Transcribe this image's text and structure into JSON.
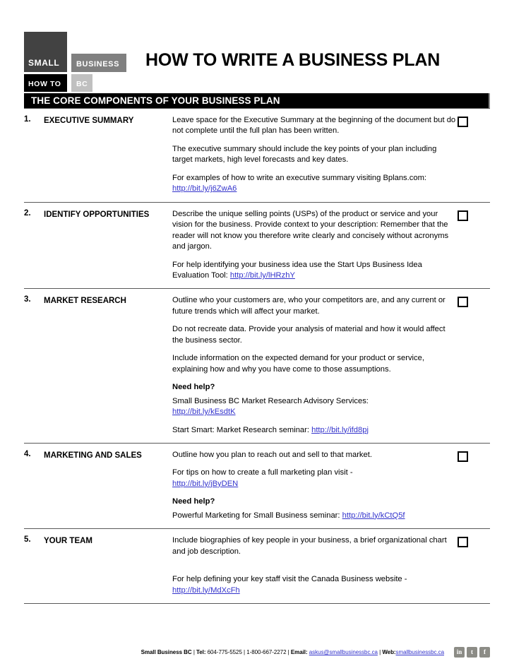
{
  "logo": {
    "small": "SMALL",
    "business": "BUSINESS",
    "how_to": "HOW TO",
    "bc": "BC",
    "colors": {
      "small_bg": "#424242",
      "business_bg": "#808080",
      "how_to_bg": "#000000",
      "bc_bg": "#c0c0c0"
    }
  },
  "title": "HOW TO WRITE A BUSINESS PLAN",
  "banner": "THE CORE COMPONENTS OF YOUR BUSINESS PLAN",
  "sections": [
    {
      "number": "1.",
      "name": "EXECUTIVE SUMMARY",
      "p1": "Leave space for the Executive Summary at the beginning of the document but do not complete until the full plan has been written.",
      "p2": "The executive summary should include the key points of your plan including target markets, high level forecasts and key dates.",
      "p3_text": "For examples of how to write an executive summary visiting Bplans.com: ",
      "p3_link": "http://bit.ly/j6ZwA6"
    },
    {
      "number": "2.",
      "name": "IDENTIFY OPPORTUNITIES",
      "p1": "Describe the unique selling points (USPs) of the product or service and your vision for the business.  Provide context to your description: Remember that the reader will not know you therefore write clearly and concisely without acronyms and jargon.",
      "p2_text": "For help identifying your business idea use the Start Ups Business Idea Evaluation Tool: ",
      "p2_link": "http://bit.ly/lHRzhY"
    },
    {
      "number": "3.",
      "name": "MARKET RESEARCH",
      "p1": "Outline who your customers are, who your competitors are, and any current or future trends which will affect your market.",
      "p2": "Do not recreate data. Provide your analysis of material and how it would affect the business sector.",
      "p3": "Include information on the expected demand for your product or service, explaining how and why you have come to those assumptions.",
      "need_help": "Need help?",
      "p4_text": "Small Business BC Market Research Advisory Services: ",
      "p4_link": "http://bit.ly/kEsdtK",
      "p5_text": "Start Smart: Market Research seminar: ",
      "p5_link": "http://bit.ly/ifd8pj"
    },
    {
      "number": "4.",
      "name": "MARKETING AND SALES",
      "p1": "Outline how you plan to reach out and sell to that market.",
      "p2_text": "For tips on how to create a full marketing plan visit - ",
      "p2_link": "http://bit.ly/jByDEN",
      "need_help": "Need help?",
      "p3_text": "Powerful Marketing for Small Business seminar: ",
      "p3_link": "http://bit.ly/kCtQ5f"
    },
    {
      "number": "5.",
      "name": "YOUR TEAM",
      "p1": "Include biographies of key people in your business, a brief organizational chart and job description.",
      "p2_text": "For help defining your key staff visit the Canada Business website - ",
      "p2_link": "http://bit.ly/MdXcFh"
    }
  ],
  "footer": {
    "org": "Small Business BC",
    "sep": " | ",
    "tel_label": "Tel:",
    "tel": " 604-775-5525",
    "toll_free": "1-800-667-2272",
    "email_label": "Email:",
    "email": "askus@smallbusinessbc.ca",
    "web_label": "Web:",
    "web": "smallbusinessbc.ca",
    "social": [
      {
        "name": "linkedin-icon",
        "glyph": "in"
      },
      {
        "name": "twitter-icon",
        "glyph": "t"
      },
      {
        "name": "facebook-icon",
        "glyph": "f"
      }
    ]
  }
}
